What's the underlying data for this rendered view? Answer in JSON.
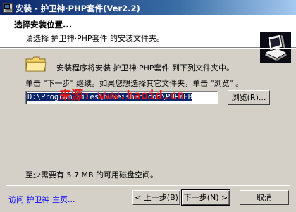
{
  "window": {
    "title": "安装 - 护卫神·PHP套件(Ver2.2)"
  },
  "header": {
    "title": "选择安装位置...",
    "subtitle": "请选择 护卫神·PHP套件 的安装文件夹。"
  },
  "body": {
    "intro": "安装程序将安装 护卫神·PHP套件 到下列文件夹中。",
    "instruction": "单击 \"下一步\" 继续。如果您想选择其它文件夹，单击 \"浏览\" 。",
    "path_value": "D:\\Program Files\\huweishen.com\\PHPWEB",
    "browse_label": "浏览(R)...",
    "space_text": "至少需要有 5.7 MB 的可用磁盘空间。",
    "watermark": "来源: www.haoid.cn"
  },
  "footer": {
    "link": "访问 护卫神 主页...",
    "back_label": "< 上一步(B)",
    "next_label": "下一步(N) >",
    "cancel_label": "取消"
  },
  "icons": {
    "app": "installer-app-icon",
    "logo": "computer-box-logo-icon",
    "folder": "folder-icon"
  },
  "colors": {
    "titlebar_start": "#0a246a",
    "titlebar_end": "#a6caf0",
    "selection": "#0a246a",
    "link": "#0000ff",
    "watermark": "#e01010"
  }
}
